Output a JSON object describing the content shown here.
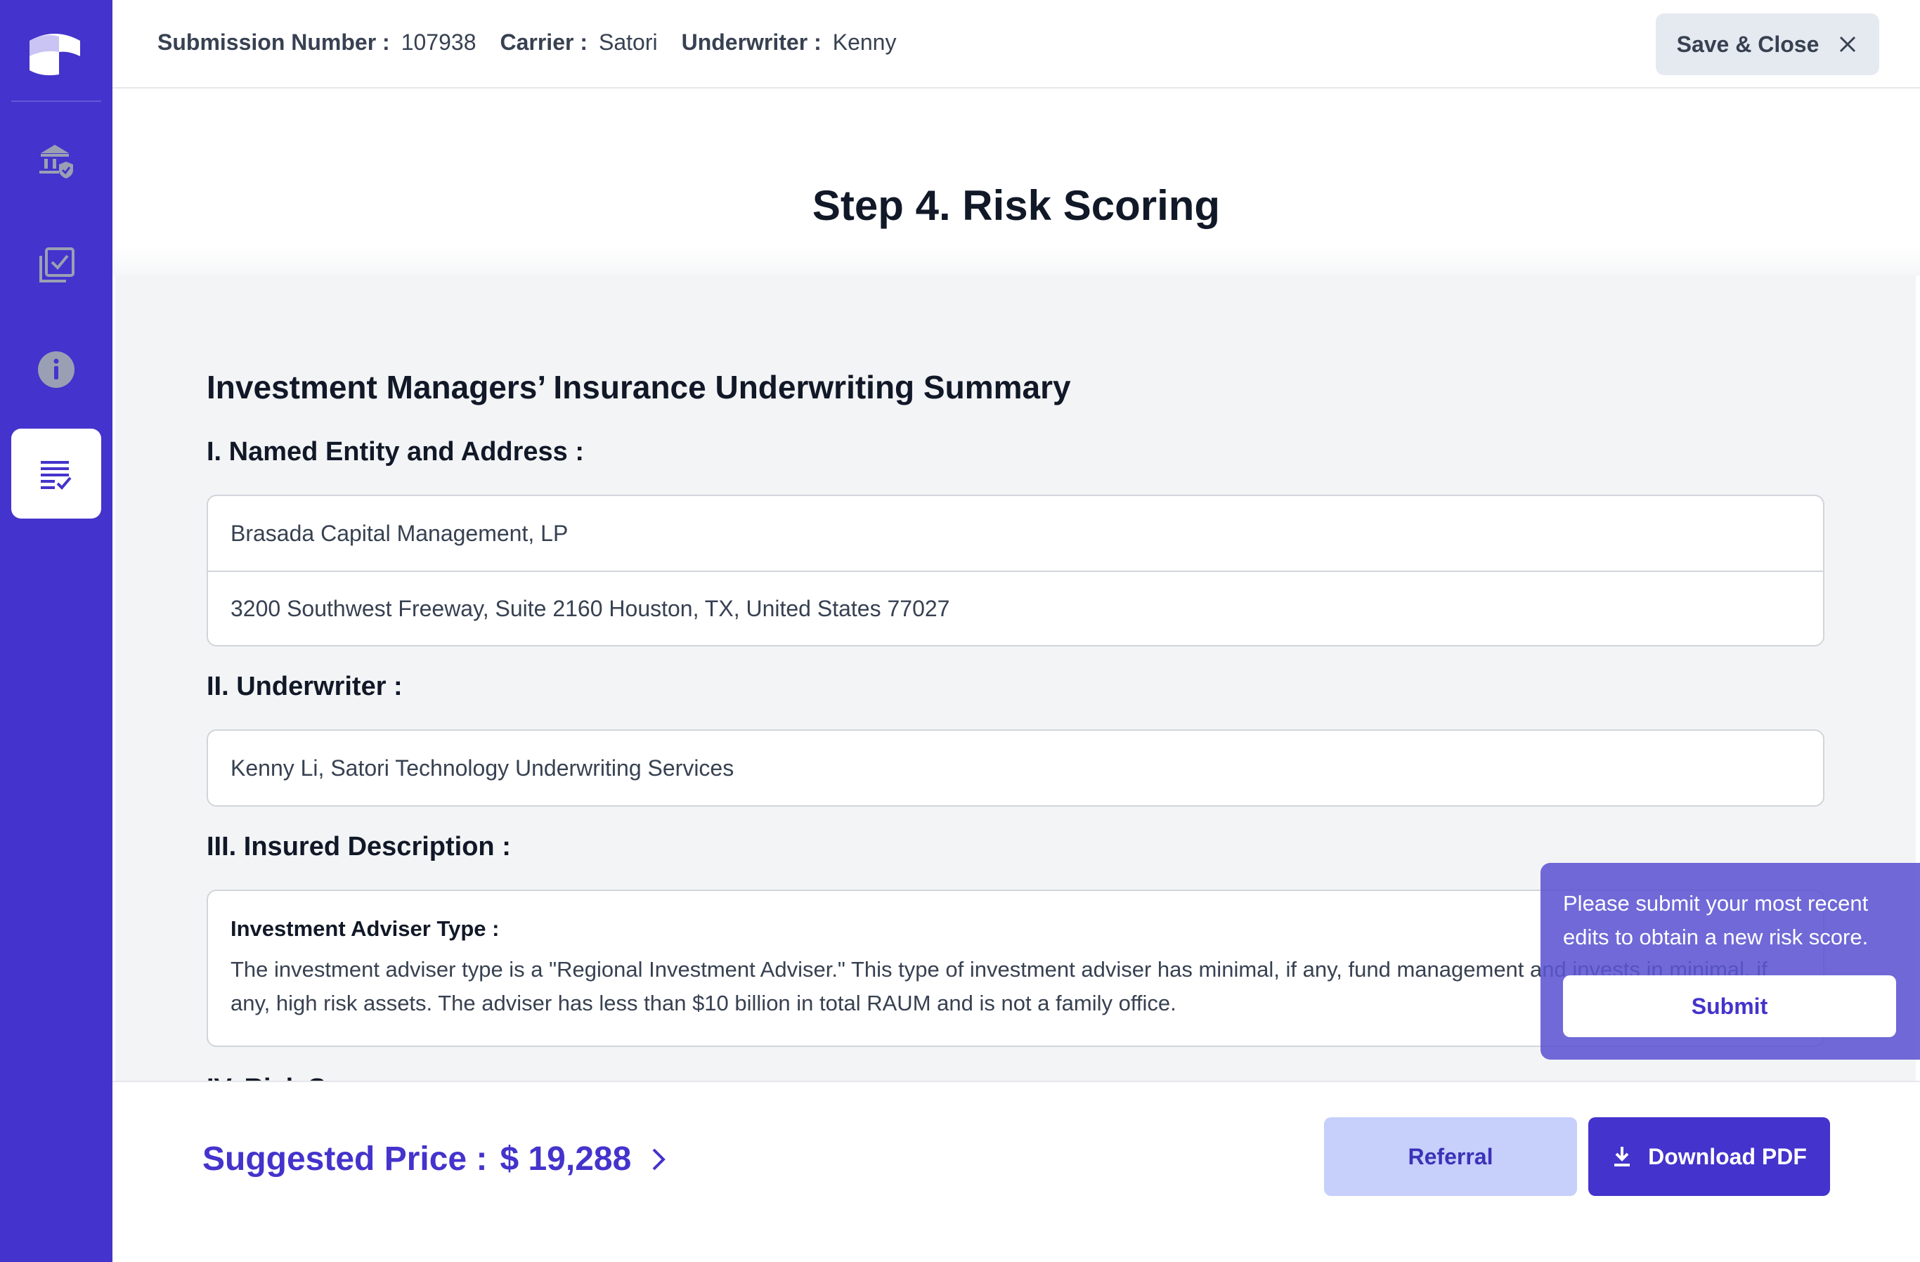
{
  "header": {
    "submission_label": "Submission Number :",
    "submission_value": "107938",
    "carrier_label": "Carrier :",
    "carrier_value": "Satori",
    "underwriter_label": "Underwriter :",
    "underwriter_value": "Kenny",
    "save_close_label": "Save & Close"
  },
  "sidebar": {
    "items": [
      {
        "icon": "bank-shield-icon",
        "active": false
      },
      {
        "icon": "checklist-box-icon",
        "active": false
      },
      {
        "icon": "info-icon",
        "active": false
      },
      {
        "icon": "summary-list-icon",
        "active": true
      }
    ]
  },
  "page": {
    "title": "Step 4. Risk Scoring"
  },
  "summary": {
    "heading": "Investment Managers’ Insurance Underwriting Summary",
    "section1_heading": "I. Named Entity and Address :",
    "entity_name": "Brasada Capital Management, LP",
    "entity_address": "3200 Southwest Freeway, Suite 2160 Houston, TX, United States 77027",
    "section2_heading": "II. Underwriter :",
    "underwriter_full": "Kenny Li, Satori Technology Underwriting Services",
    "section3_heading": "III. Insured Description :",
    "adviser_type_label": "Investment Adviser Type :",
    "adviser_type_text": "The investment adviser type is a \"Regional Investment Adviser.\" This type of investment adviser has minimal, if any, fund management and invests in minimal, if any, high risk assets. The adviser has less than $10 billion in total RAUM and is not a family office.",
    "section4_heading_partial": "IV. Risk S"
  },
  "toast": {
    "message": "Please submit your most recent edits to obtain a new risk score.",
    "submit_label": "Submit"
  },
  "footer": {
    "price_label": "Suggested Price :",
    "price_value": "$ 19,288",
    "referral_label": "Referral",
    "download_label": "Download PDF"
  },
  "colors": {
    "brand": "#4433cc",
    "referral_bg": "#c7cffb",
    "content_bg": "#f3f4f6"
  }
}
